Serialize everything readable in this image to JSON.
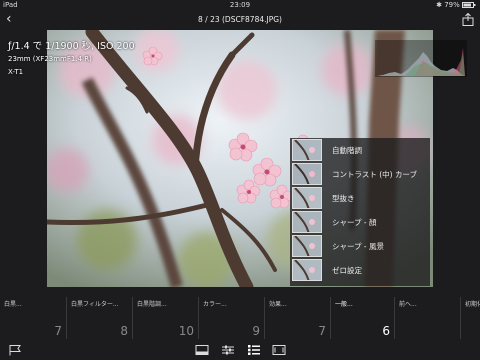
{
  "status_bar": {
    "device": "iPad",
    "time": "23:09",
    "battery": "79%"
  },
  "header": {
    "title": "8 / 23 (DSCF8784.JPG)"
  },
  "exif": {
    "exposure": "ƒ/1.4 で 1/1900 秒, ISO 200",
    "lens": "23mm (XF23mmF1.4 R)",
    "camera": "X-T1"
  },
  "presets": [
    {
      "label": "自動階調"
    },
    {
      "label": "コントラスト (中) カーブ"
    },
    {
      "label": "型抜き"
    },
    {
      "label": "シャープ - 顔"
    },
    {
      "label": "シャープ - 風景"
    },
    {
      "label": "ゼロ設定"
    }
  ],
  "categories": [
    {
      "name": "白黒...",
      "count": "7"
    },
    {
      "name": "白黒フィルター...",
      "count": "8"
    },
    {
      "name": "白黒階調...",
      "count": "10"
    },
    {
      "name": "カラー...",
      "count": "9"
    },
    {
      "name": "効果...",
      "count": "7"
    },
    {
      "name": "一般...",
      "count": "6",
      "active": true
    },
    {
      "name": "前へ...",
      "count": ""
    },
    {
      "name": "初期化",
      "count": ""
    }
  ],
  "toolbar": {
    "icons": [
      "flag-icon",
      "crop-mode-icon",
      "adjust-sliders-icon",
      "presets-list-icon",
      "compare-icon"
    ]
  },
  "colors": {
    "background": "#1c1c1e",
    "accent": "#ffffff",
    "divider": "#3a3a3c"
  }
}
